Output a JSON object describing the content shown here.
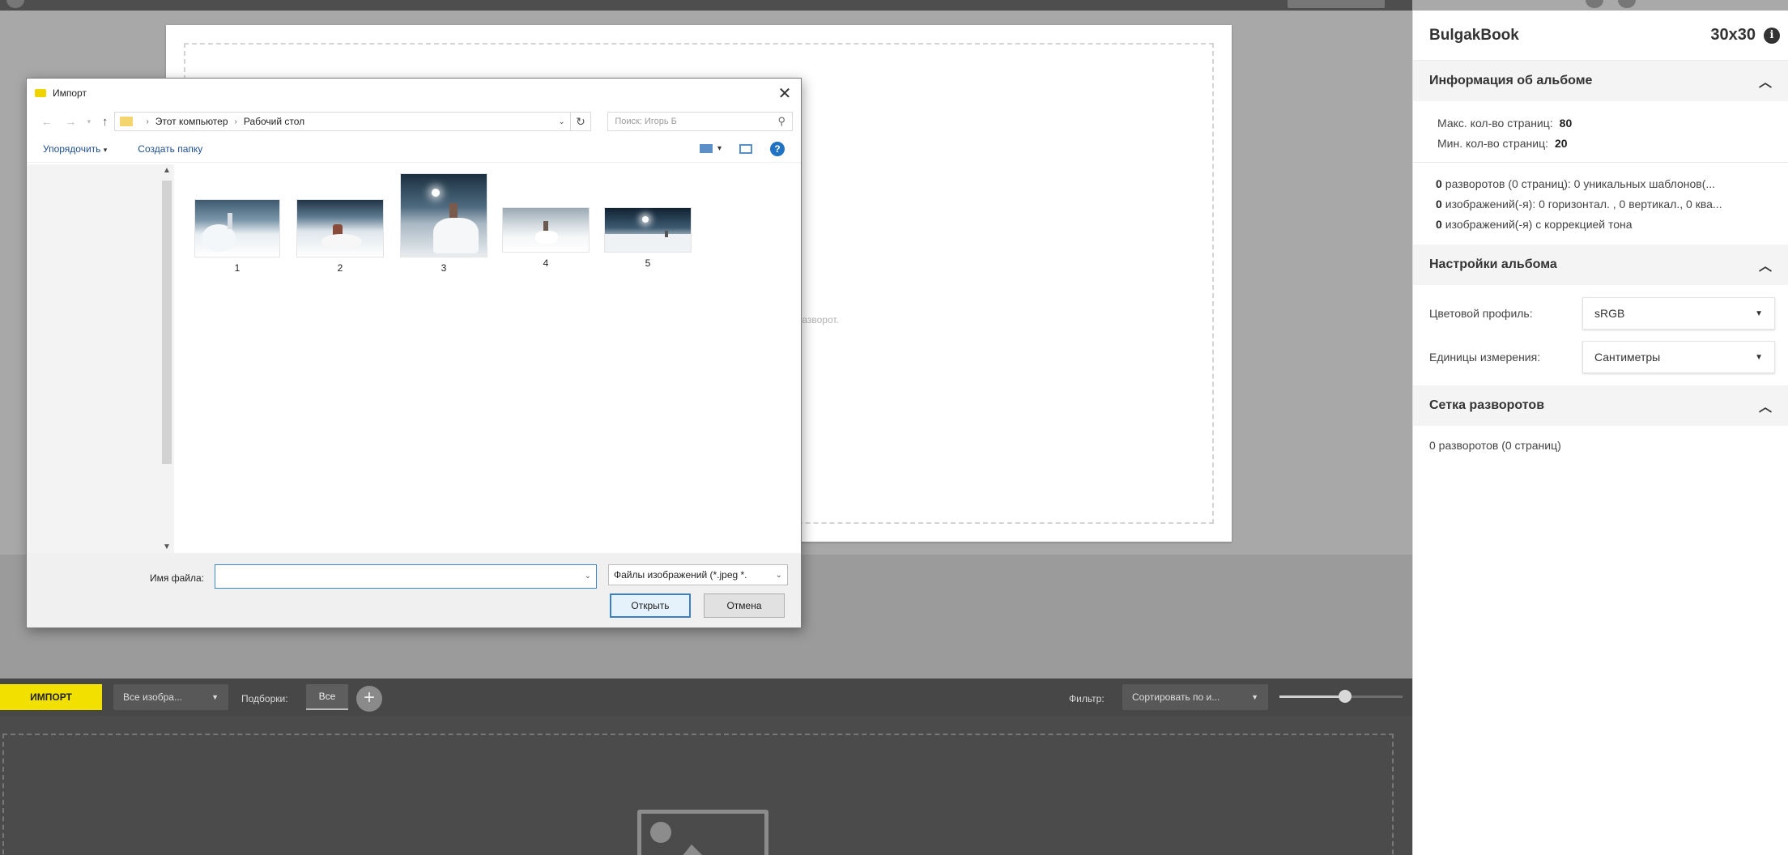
{
  "canvas": {
    "hint": "ый разворот."
  },
  "bottombar": {
    "import_label": "ИМПОРТ",
    "images_filter": "Все изобра...",
    "collections_label": "Подборки:",
    "tab_all": "Все",
    "add_symbol": "+",
    "filter_label": "Фильтр:",
    "sort_value": "Сортировать по и...",
    "zoom_level": 0.53
  },
  "panel": {
    "title": "BulgakBook",
    "size": "30x30",
    "sections": {
      "album_info": {
        "title": "Информация об альбоме",
        "max_pages_label": "Макс. кол-во страниц:",
        "max_pages": "80",
        "min_pages_label": "Мин. кол-во страниц:",
        "min_pages": "20",
        "spreads_count": "0",
        "spreads_text": "разворотов (0 страниц): 0 уникальных шаблонов(...",
        "images_count": "0",
        "images_text": "изображений(-я): 0 горизонтал. , 0 вертикал., 0 ква...",
        "corrected_count": "0",
        "corrected_text": "изображений(-я) с коррекцией тона"
      },
      "album_settings": {
        "title": "Настройки альбома",
        "color_profile_label": "Цветовой профиль:",
        "color_profile_value": "sRGB",
        "units_label": "Единицы измерения:",
        "units_value": "Сантиметры"
      },
      "spread_grid": {
        "title": "Сетка разворотов",
        "text": "0 разворотов (0 страниц)"
      }
    }
  },
  "dialog": {
    "title": "Импорт",
    "path": [
      "Этот компьютер",
      "Рабочий стол"
    ],
    "search_placeholder": "Поиск: Игорь Б",
    "organize_label": "Упорядочить",
    "new_folder_label": "Создать папку",
    "files": [
      {
        "name": "1",
        "icon": "photo-bride-sky"
      },
      {
        "name": "2",
        "icon": "photo-bride-sitting"
      },
      {
        "name": "3",
        "icon": "photo-bride-portrait"
      },
      {
        "name": "4",
        "icon": "photo-bride-standing"
      },
      {
        "name": "5",
        "icon": "photo-bride-horizon"
      }
    ],
    "filename_label": "Имя файла:",
    "filename_value": "",
    "filetype_value": "Файлы изображений (*.jpeg *.",
    "open_label": "Открыть",
    "cancel_label": "Отмена"
  },
  "colors": {
    "accent": "#f2e100",
    "panel_bg": "#ffffff",
    "workspace_bg": "#a8a8a8",
    "library_bg": "#4b4b4b",
    "dialog_focus": "#3c7fc2"
  }
}
